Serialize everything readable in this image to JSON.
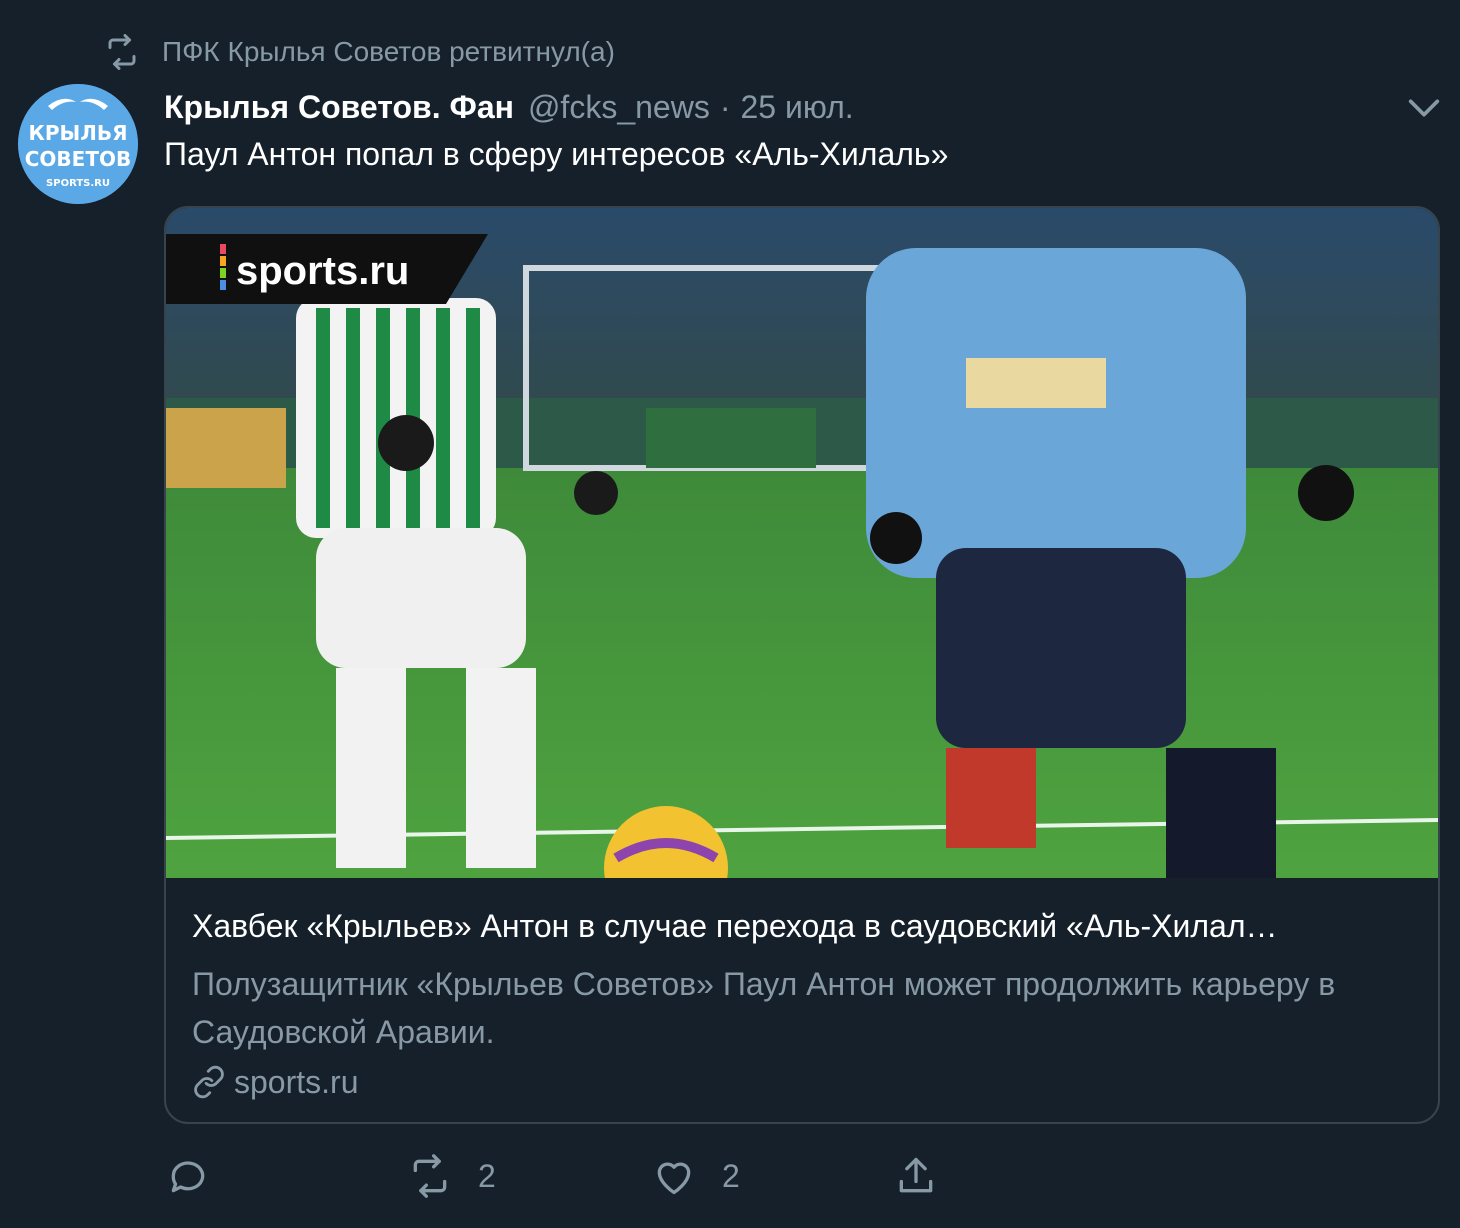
{
  "retweet": {
    "icon": "retweet-icon",
    "text": "ПФК Крылья Советов ретвитнул(а)"
  },
  "author": {
    "avatar_text_line1": "КРЫЛЬЯ",
    "avatar_text_line2": "СОВЕТОВ",
    "avatar_text_line3": "SPORTS.RU",
    "display_name": "Крылья Советов. Фан",
    "handle": "@fcks_news",
    "separator": "·",
    "date": "25 июл."
  },
  "tweet": {
    "text": "Паул Антон попал в сферу интересов «Аль-Хилаль»"
  },
  "card": {
    "image_logo": "sports.ru",
    "title": "Хавбек «Крыльев» Антон в случае перехода в саудовский «Аль-Хилал…",
    "description": "Полузащитник «Крыльев Советов» Паул Антон может продолжить карьеру в Саудовской Аравии.",
    "domain": "sports.ru"
  },
  "actions": {
    "reply_count": "",
    "retweet_count": "2",
    "like_count": "2"
  },
  "colors": {
    "background": "#15202b",
    "secondary_text": "#8899a6",
    "border": "#38444d"
  }
}
